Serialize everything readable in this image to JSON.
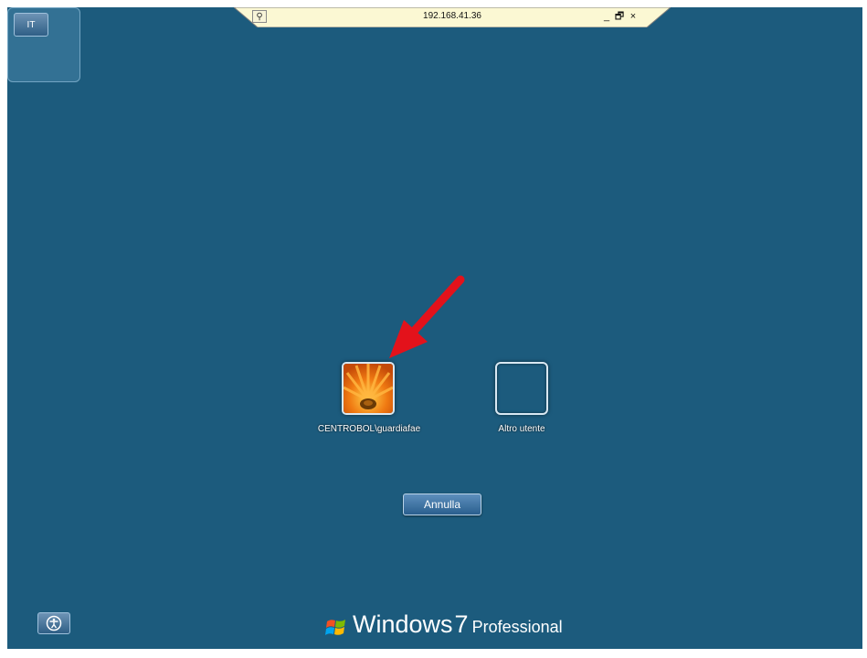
{
  "rdp_bar": {
    "address": "192.168.41.36",
    "pin_icon": "pin-icon",
    "minimize": "_",
    "restore": "🗗",
    "close": "×"
  },
  "language": {
    "label": "IT"
  },
  "users": [
    {
      "name": "CENTROBOL\\guardiafae",
      "picture": "orange-flower"
    },
    {
      "name": "Altro utente",
      "picture": "empty"
    }
  ],
  "cancel_button": {
    "label": "Annulla"
  },
  "branding": {
    "windows": "Windows",
    "version": "7",
    "edition": "Professional"
  },
  "colors": {
    "background": "#1c5b7d",
    "annotation_arrow": "#e3121b"
  }
}
